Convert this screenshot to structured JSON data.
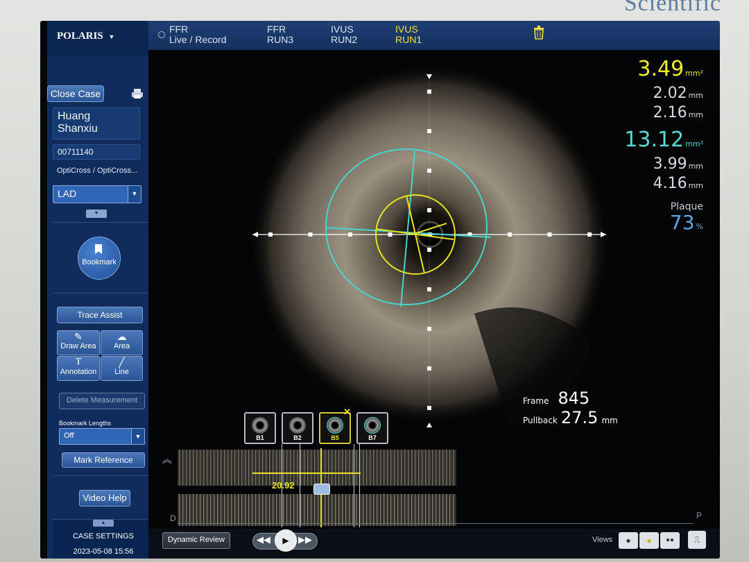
{
  "device": {
    "brand": "Scientific"
  },
  "app": {
    "name": "POLARIS"
  },
  "tabs": [
    {
      "line1": "FFR",
      "line2": "Live / Record"
    },
    {
      "line1": "FFR",
      "line2": "RUN3"
    },
    {
      "line1": "IVUS",
      "line2": "RUN2"
    },
    {
      "line1": "IVUS",
      "line2": "RUN1"
    }
  ],
  "patient": {
    "name_line1": "Huang",
    "name_line2": "Shanxiu",
    "id": "00711140",
    "catheter": "OptiCross / OptiCross...",
    "vessel": "LAD"
  },
  "sidebar": {
    "close_case": "Close Case",
    "bookmark": "Bookmark",
    "trace_assist": "Trace Assist",
    "draw_area": "Draw Area",
    "area": "Area",
    "annotation": "Annotation",
    "line": "Line",
    "delete_measurement": "Delete Measurement",
    "bookmark_lengths_label": "Bookmark Lengths",
    "bookmark_lengths_value": "Off",
    "mark_reference": "Mark Reference",
    "video_help": "Video Help",
    "case_settings": "CASE SETTINGS",
    "datetime": "2023-05-08 15:56"
  },
  "measurements": {
    "units": {
      "area": "mm²",
      "length": "mm"
    },
    "lumen": {
      "area": "3.49",
      "min_d": "2.02",
      "max_d": "2.16",
      "color": "#f2ea2c"
    },
    "eem": {
      "area": "13.12",
      "min_d": "3.99",
      "max_d": "4.16",
      "color": "#56dcd4"
    },
    "plaque": {
      "label": "Plaque",
      "value": "73",
      "unit": "%"
    }
  },
  "frame_info": {
    "frame_label": "Frame",
    "frame": "845",
    "pullback_label": "Pullback",
    "pullback": "27.5",
    "pullback_unit": "mm"
  },
  "thumbnails": [
    "B1",
    "B2",
    "B5",
    "B7"
  ],
  "longitudinal": {
    "length": "20.92",
    "distal": "D",
    "proximal": "P"
  },
  "bottom": {
    "dynamic_review": "Dynamic Review",
    "views_label": "Views"
  }
}
